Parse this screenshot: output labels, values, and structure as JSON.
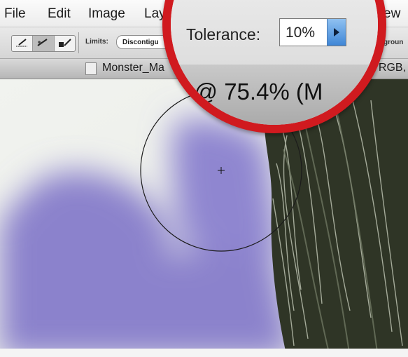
{
  "menu": {
    "file": "File",
    "edit": "Edit",
    "image": "Image",
    "layer_fragment": "Lay",
    "view_fragment": "ew"
  },
  "options": {
    "limits_label": "Limits:",
    "limits_value": "Discontigu",
    "right_fragment": "groun"
  },
  "document": {
    "title_visible": "Monster_Ma",
    "title_right_fragment": ", RGB,"
  },
  "callout": {
    "tolerance_label": "Tolerance:",
    "tolerance_value": "10%",
    "zoom_title_fragment": "d @ 75.4% (M"
  },
  "colors": {
    "callout_ring": "#d01a1f",
    "purple_paint": "#8b82cc",
    "hair_dark": "#2f3526"
  },
  "icons": [
    "sampling-continuous-icon",
    "sampling-once-icon",
    "sampling-background-swatch-icon",
    "doc-icon",
    "arrow-right-icon",
    "brush-cursor-icon"
  ]
}
